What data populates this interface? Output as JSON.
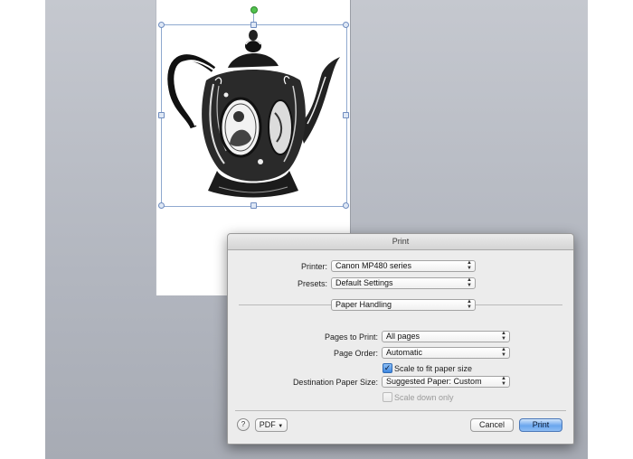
{
  "dialog": {
    "title": "Print",
    "printer": {
      "label": "Printer:",
      "value": "Canon MP480 series"
    },
    "presets": {
      "label": "Presets:",
      "value": "Default Settings"
    },
    "section": {
      "value": "Paper Handling"
    },
    "pages_to_print": {
      "label": "Pages to Print:",
      "value": "All pages"
    },
    "page_order": {
      "label": "Page Order:",
      "value": "Automatic"
    },
    "scale_to_fit": {
      "label": "Scale to fit paper size",
      "checked": true
    },
    "destination_paper_size": {
      "label": "Destination Paper Size:",
      "value": "Suggested Paper: Custom"
    },
    "scale_down_only": {
      "label": "Scale down only",
      "checked": false,
      "enabled": false
    },
    "help": "?",
    "pdf_button": "PDF",
    "cancel_button": "Cancel",
    "print_button": "Print"
  },
  "document": {
    "image": "teapot-illustration"
  },
  "colors": {
    "desktop": "#b8bcc4",
    "default_button": "#6aa6ee",
    "rotate_handle": "#52c24f"
  }
}
